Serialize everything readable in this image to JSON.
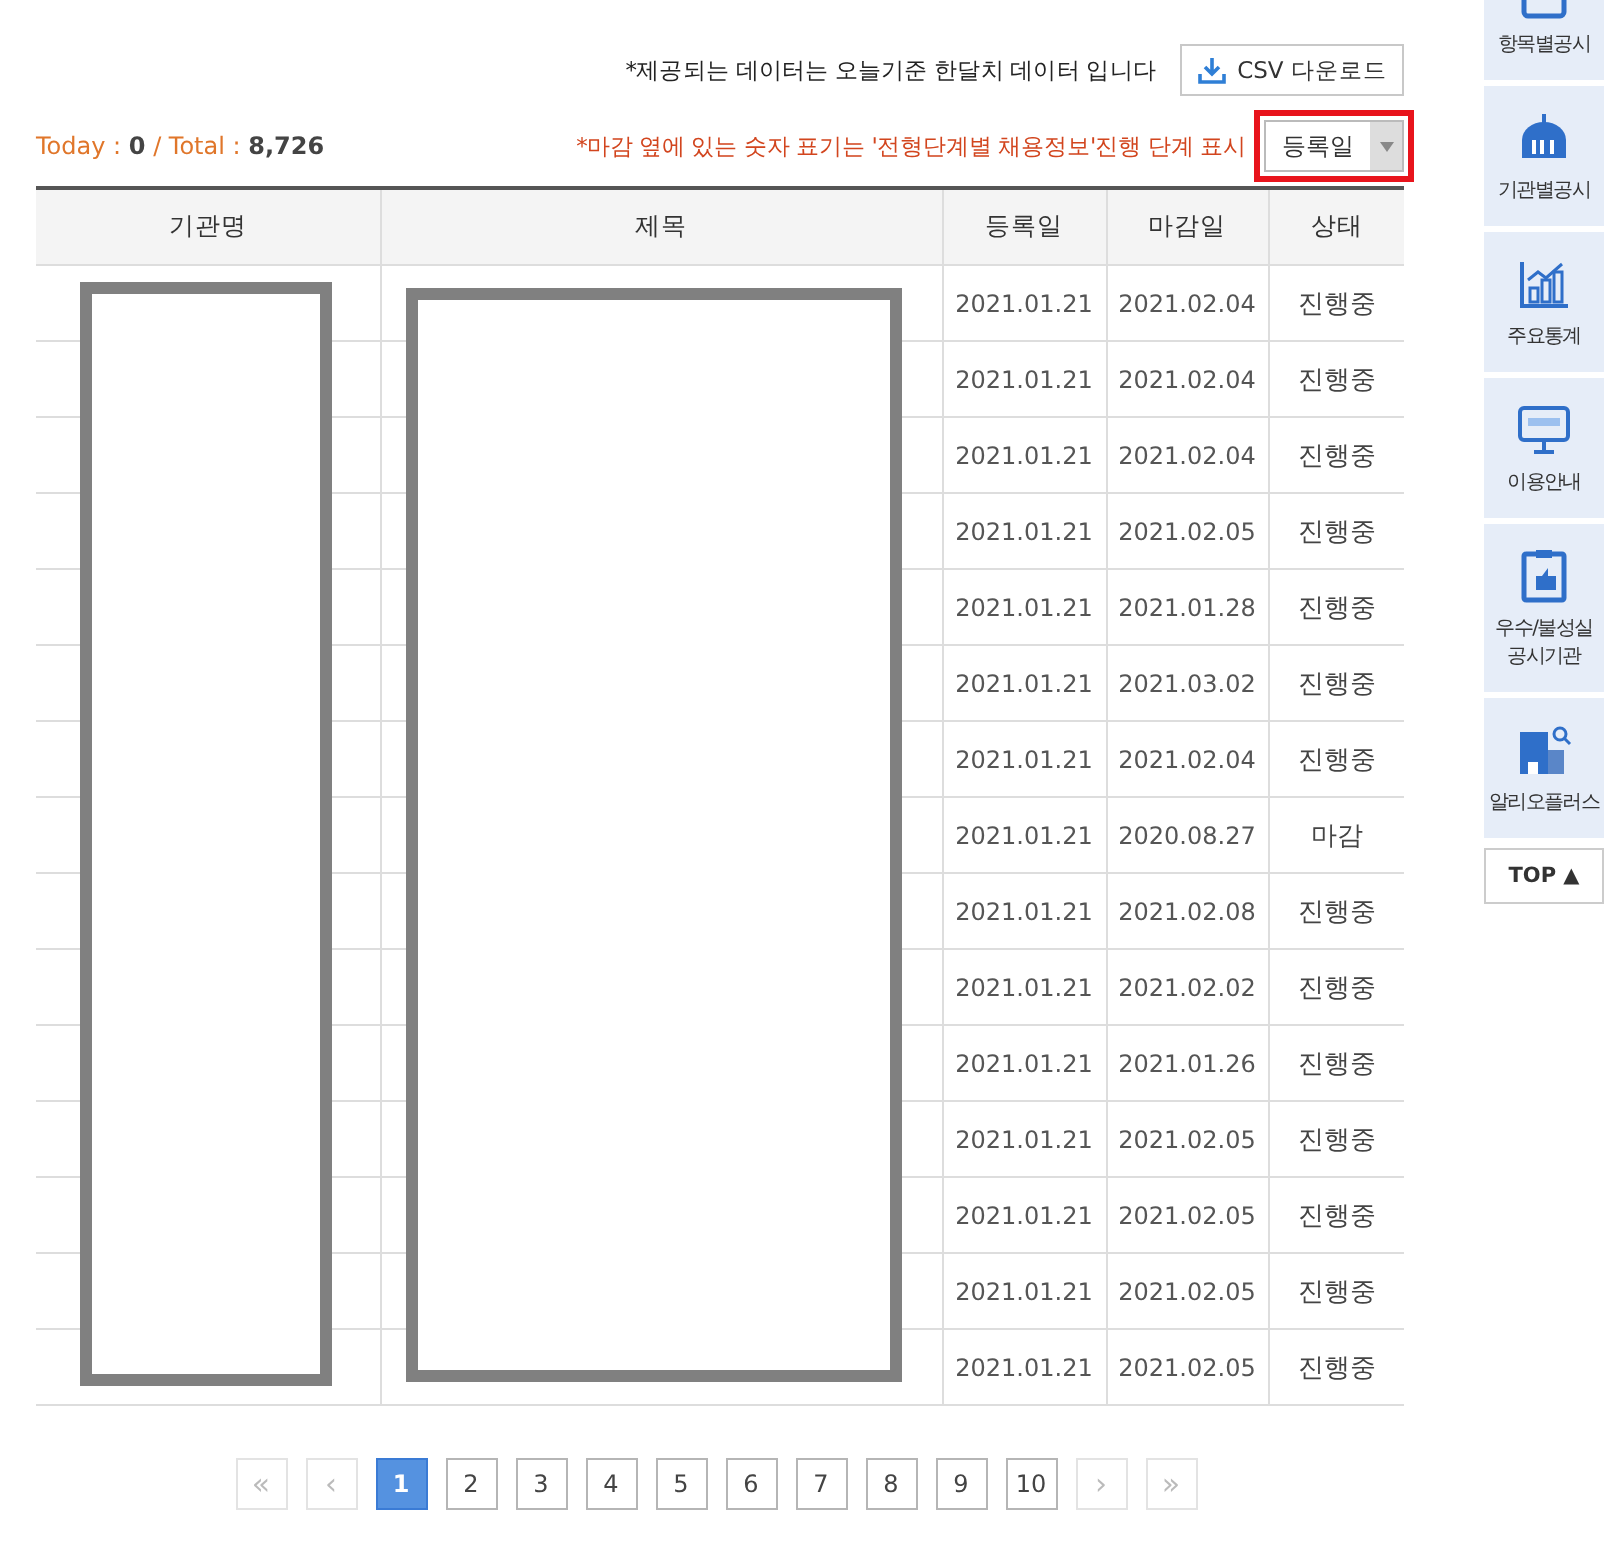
{
  "notice": "*제공되는 데이터는 오늘기준 한달치 데이터 입니다",
  "csv_button": "CSV 다운로드",
  "stats": "Today : **0** / Total : **8,726**",
  "stage_notice": "*마감 옆에 있는 숫자 표기는 '전형단계별 채용정보'진행 단계 표시",
  "sort_select": {
    "value": "등록일",
    "highlighted": true
  },
  "table": {
    "columns": [
      "기관명",
      "제목",
      "등록일",
      "마감일",
      "상태"
    ],
    "rows": [
      {
        "registered": "2021.01.21",
        "deadline": "2021.02.04",
        "status": "진행중"
      },
      {
        "registered": "2021.01.21",
        "deadline": "2021.02.04",
        "status": "진행중"
      },
      {
        "registered": "2021.01.21",
        "deadline": "2021.02.04",
        "status": "진행중"
      },
      {
        "registered": "2021.01.21",
        "deadline": "2021.02.05",
        "status": "진행중"
      },
      {
        "registered": "2021.01.21",
        "deadline": "2021.01.28",
        "status": "진행중"
      },
      {
        "registered": "2021.01.21",
        "deadline": "2021.03.02",
        "status": "진행중"
      },
      {
        "registered": "2021.01.21",
        "deadline": "2021.02.04",
        "status": "진행중"
      },
      {
        "registered": "2021.01.21",
        "deadline": "2020.08.27",
        "status": "마감"
      },
      {
        "registered": "2021.01.21",
        "deadline": "2021.02.08",
        "status": "진행중"
      },
      {
        "registered": "2021.01.21",
        "deadline": "2021.02.02",
        "status": "진행중"
      },
      {
        "registered": "2021.01.21",
        "deadline": "2021.01.26",
        "status": "진행중"
      },
      {
        "registered": "2021.01.21",
        "deadline": "2021.02.05",
        "status": "진행중"
      },
      {
        "registered": "2021.01.21",
        "deadline": "2021.02.05",
        "status": "진행중"
      },
      {
        "registered": "2021.01.21",
        "deadline": "2021.02.05",
        "status": "진행중"
      },
      {
        "registered": "2021.01.21",
        "deadline": "2021.02.05",
        "status": "진행중"
      }
    ]
  },
  "pagination": [
    {
      "kind": "first",
      "label": "«",
      "selected": false,
      "disabled": true
    },
    {
      "kind": "prev",
      "label": "‹",
      "selected": false,
      "disabled": true
    },
    {
      "kind": "page",
      "label": "1",
      "selected": true,
      "disabled": false
    },
    {
      "kind": "page",
      "label": "2",
      "selected": false,
      "disabled": false
    },
    {
      "kind": "page",
      "label": "3",
      "selected": false,
      "disabled": false
    },
    {
      "kind": "page",
      "label": "4",
      "selected": false,
      "disabled": false
    },
    {
      "kind": "page",
      "label": "5",
      "selected": false,
      "disabled": false
    },
    {
      "kind": "page",
      "label": "6",
      "selected": false,
      "disabled": false
    },
    {
      "kind": "page",
      "label": "7",
      "selected": false,
      "disabled": false
    },
    {
      "kind": "page",
      "label": "8",
      "selected": false,
      "disabled": false
    },
    {
      "kind": "page",
      "label": "9",
      "selected": false,
      "disabled": false
    },
    {
      "kind": "page",
      "label": "10",
      "selected": false,
      "disabled": false
    },
    {
      "kind": "next",
      "label": "›",
      "selected": false,
      "disabled": true
    },
    {
      "kind": "last",
      "label": "»",
      "selected": false,
      "disabled": true
    }
  ],
  "sidebar": [
    {
      "kind": "checklist",
      "label": "항목별공시"
    },
    {
      "kind": "building",
      "label": "기관별공시"
    },
    {
      "kind": "chart",
      "label": "주요통계"
    },
    {
      "kind": "monitor",
      "label": "이용안내"
    },
    {
      "kind": "clipboard",
      "label": "우수/불성실\n공시기관"
    },
    {
      "kind": "office",
      "label": "알리오플러스"
    }
  ],
  "top_button": "TOP ▲"
}
